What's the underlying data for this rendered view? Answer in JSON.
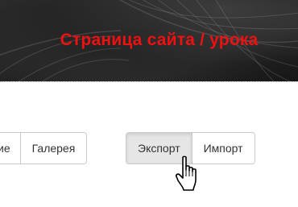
{
  "banner": {
    "title": "Страница сайта / урока"
  },
  "left_group": {
    "buttons": [
      {
        "label": "ие"
      },
      {
        "label": "Галерея"
      }
    ]
  },
  "right_group": {
    "buttons": [
      {
        "label": "Экспорт",
        "active": true
      },
      {
        "label": "Импорт",
        "active": false
      }
    ]
  },
  "colors": {
    "title": "#ee1111",
    "banner_background": "#1e1e1e",
    "active_button": "#e6e6e6"
  },
  "icons": {
    "cursor": "hand-pointer-icon",
    "banner_decoration": "feather-icon"
  }
}
